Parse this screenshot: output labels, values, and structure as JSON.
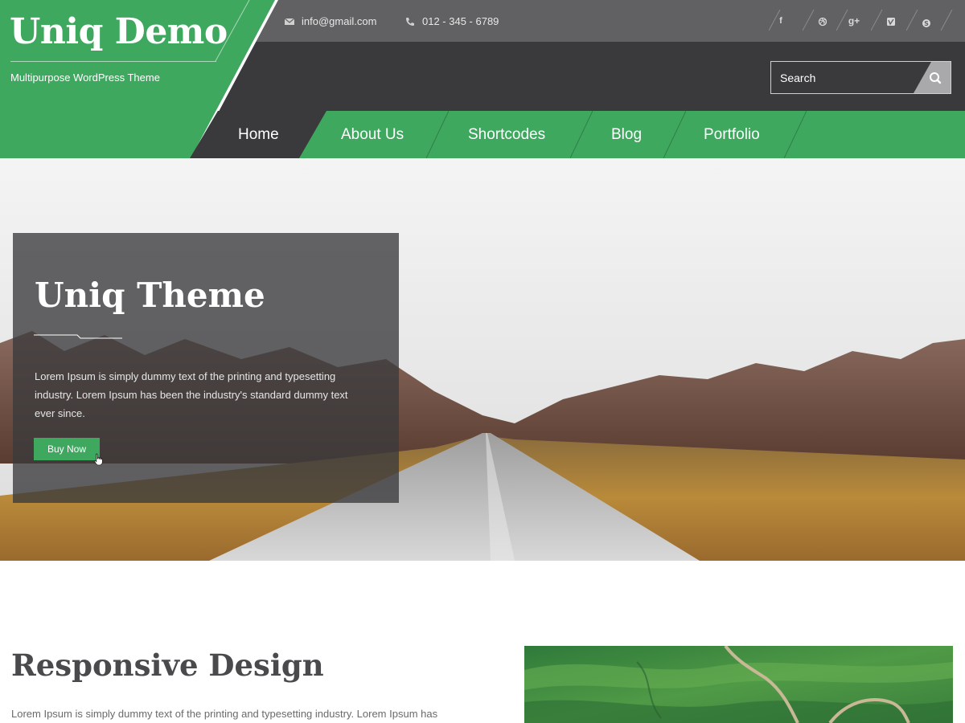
{
  "site": {
    "title": "Uniq Demo",
    "tagline": "Multipurpose WordPress Theme"
  },
  "topbar": {
    "email": "info@gmail.com",
    "phone": "012 - 345 - 6789",
    "social": [
      "facebook-icon",
      "dribbble-icon",
      "google-plus-icon",
      "vimeo-icon",
      "skype-icon"
    ]
  },
  "search": {
    "placeholder": "Search"
  },
  "nav": {
    "items": [
      {
        "label": "Home"
      },
      {
        "label": "About Us"
      },
      {
        "label": "Shortcodes"
      },
      {
        "label": "Blog"
      },
      {
        "label": "Portfolio"
      }
    ]
  },
  "hero": {
    "title": "Uniq Theme",
    "text": "Lorem Ipsum is simply dummy text of the printing and typesetting industry. Lorem Ipsum has been the industry's standard dummy text ever since.",
    "button": "Buy Now"
  },
  "section": {
    "title": "Responsive Design",
    "text": "Lorem Ipsum is simply dummy text of the printing and typesetting industry. Lorem Ipsum has"
  },
  "colors": {
    "accent": "#3ea85f",
    "topbar": "#616163",
    "header": "#3a3a3c",
    "heading": "#4a4a4c"
  }
}
